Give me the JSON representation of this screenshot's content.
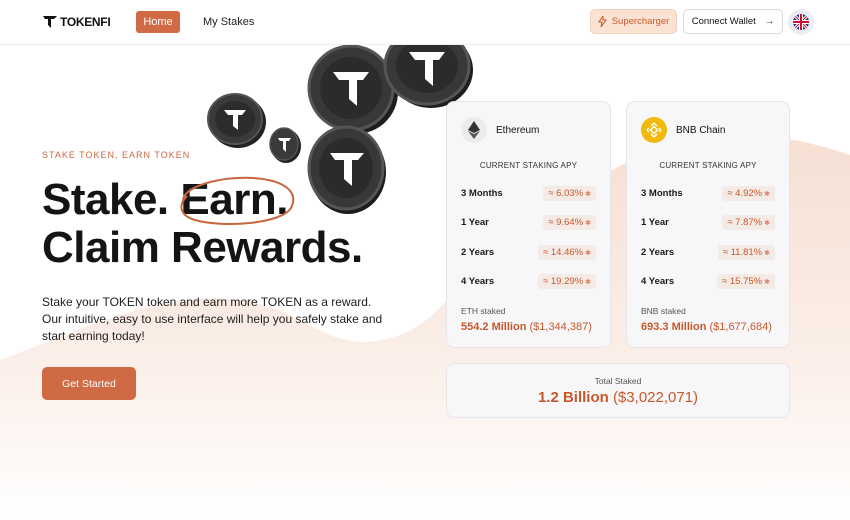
{
  "header": {
    "logo_text": "TOKENFI",
    "nav": {
      "home": "Home",
      "my_stakes": "My Stakes"
    },
    "supercharger_label": "Supercharger",
    "connect_label": "Connect Wallet",
    "language": "UK flag"
  },
  "hero": {
    "eyebrow": "STAKE TOKEN, EARN TOKEN",
    "title_line1_a": "Stake.",
    "title_line1_b": "Earn",
    "title_line1_c": ".",
    "title_line2": "Claim Rewards.",
    "description": "Stake your TOKEN token and earn more TOKEN as a reward. Our intuitive, easy to use interface will help you safely stake and start earning today!",
    "cta": "Get Started"
  },
  "cards": {
    "eth": {
      "name": "Ethereum",
      "apy_title": "CURRENT STAKING APY",
      "rows": [
        {
          "label": "3 Months",
          "value": "≈ 6.03%"
        },
        {
          "label": "1 Year",
          "value": "≈ 9.64%"
        },
        {
          "label": "2 Years",
          "value": "≈ 14.46%"
        },
        {
          "label": "4 Years",
          "value": "≈ 19.29%"
        }
      ],
      "staked_label": "ETH staked",
      "staked_amount": "554.2 Million",
      "staked_usd": "($1,344,387)"
    },
    "bnb": {
      "name": "BNB Chain",
      "apy_title": "CURRENT STAKING APY",
      "rows": [
        {
          "label": "3 Months",
          "value": "≈ 4.92%"
        },
        {
          "label": "1 Year",
          "value": "≈ 7.87%"
        },
        {
          "label": "2 Years",
          "value": "≈ 11.81%"
        },
        {
          "label": "4 Years",
          "value": "≈ 15.75%"
        }
      ],
      "staked_label": "BNB staked",
      "staked_amount": "693.3 Million",
      "staked_usd": "($1,677,684)"
    },
    "total": {
      "label": "Total Staked",
      "amount": "1.2 Billion",
      "usd": "($3,022,071)"
    }
  },
  "colors": {
    "accent": "#cf6a45",
    "accent_text": "#c8582c",
    "card_bg": "#f7f7f9",
    "wave": "#fbeee7"
  }
}
